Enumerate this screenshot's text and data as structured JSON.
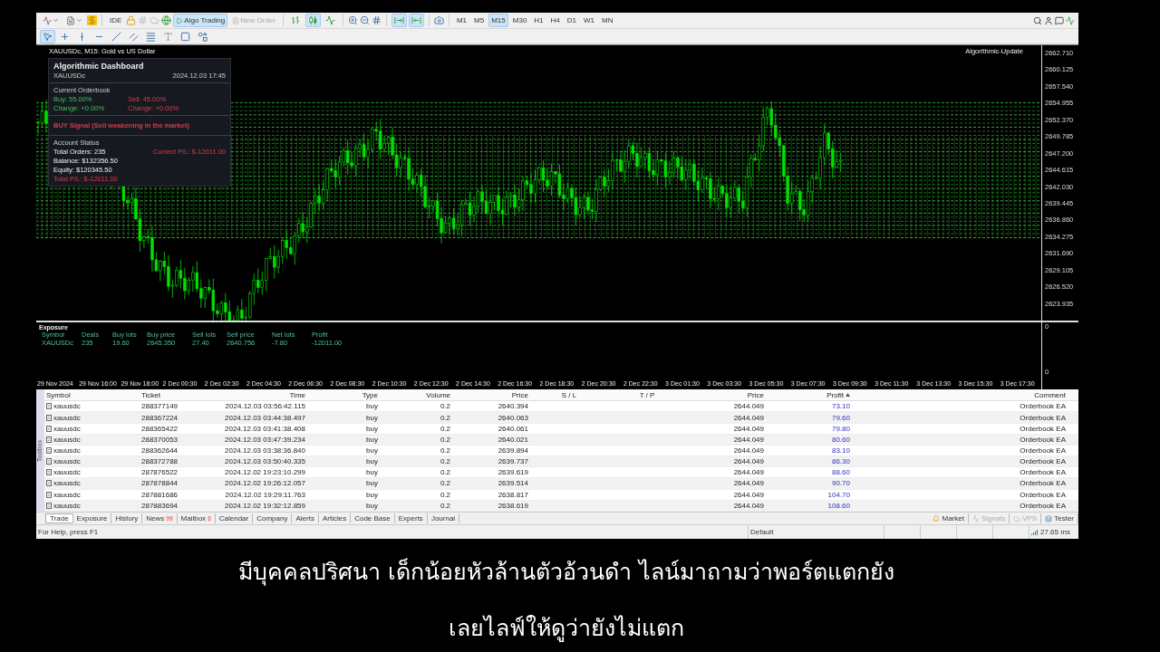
{
  "toolbar": {
    "ide_label": "IDE",
    "algo_trading": {
      "label": "Algo Trading",
      "on": true
    },
    "new_order": {
      "label": "New Order",
      "disabled": true
    },
    "chart_toggles": [
      {
        "kind": "bars",
        "selected": false
      },
      {
        "kind": "candles",
        "selected": true
      },
      {
        "kind": "line",
        "selected": false
      }
    ],
    "scroll_toggles": [
      {
        "kind": "autoscroll",
        "selected": true
      },
      {
        "kind": "shift",
        "selected": true
      }
    ],
    "timeframes": [
      {
        "label": "M1",
        "selected": false
      },
      {
        "label": "M5",
        "selected": false
      },
      {
        "label": "M15",
        "selected": true
      },
      {
        "label": "M30",
        "selected": false
      },
      {
        "label": "H1",
        "selected": false
      },
      {
        "label": "H4",
        "selected": false
      },
      {
        "label": "D1",
        "selected": false
      },
      {
        "label": "W1",
        "selected": false
      },
      {
        "label": "MN",
        "selected": false
      }
    ],
    "tools": [
      {
        "kind": "cursor",
        "selected": true
      },
      {
        "kind": "crosshair",
        "selected": false
      },
      {
        "kind": "vline",
        "selected": false
      },
      {
        "kind": "hline",
        "selected": false
      },
      {
        "kind": "trend",
        "selected": false
      },
      {
        "kind": "channel",
        "selected": false
      },
      {
        "kind": "fibo",
        "selected": false
      },
      {
        "kind": "text",
        "selected": false
      },
      {
        "kind": "rect",
        "selected": false
      },
      {
        "kind": "shapes",
        "selected": false
      }
    ]
  },
  "chart": {
    "symbol_label": "XAUUSDc, M15:  Gold vs US Dollar",
    "indicator_label": "Algorithmic-Update",
    "price_ticks": [
      "2662.710",
      "2660.125",
      "2657.540",
      "2654.955",
      "2652.370",
      "2649.785",
      "2647.200",
      "2644.615",
      "2642.030",
      "2639.445",
      "2636.860",
      "2634.275",
      "2631.690",
      "2629.105",
      "2626.520",
      "2623.935"
    ],
    "time_ticks": [
      "29 Nov 2024",
      "29 Nov 16:00",
      "29 Nov 18:00",
      "2 Dec 00:30",
      "2 Dec 02:30",
      "2 Dec 04:30",
      "2 Dec 06:30",
      "2 Dec 08:30",
      "2 Dec 10:30",
      "2 Dec 12:30",
      "2 Dec 14:30",
      "2 Dec 16:30",
      "2 Dec 18:30",
      "2 Dec 20:30",
      "2 Dec 22:30",
      "3 Dec 01:30",
      "3 Dec 03:30",
      "3 Dec 05:30",
      "3 Dec 07:30",
      "3 Dec 09:30",
      "3 Dec 11:30",
      "3 Dec 13:30",
      "3 Dec 15:30",
      "3 Dec 17:30"
    ]
  },
  "dashboard": {
    "title": "Algorithmic Dashboard",
    "symbol": "XAUUSDc",
    "datetime": "2024.12.03 17:45",
    "orderbook_title": "Current Orderbook",
    "buy": "Buy: 55.00%",
    "sell": "Sell: 45.00%",
    "buy_change": "Change: +0.00%",
    "sell_change": "Change: +0.00%",
    "signal": "BUY Signal (Sell weakening in the market)",
    "account_title": "Account Status",
    "total_orders": "Total Orders: 235",
    "current_pl": "Current P/L: $-12011.00",
    "balance": "Balance: $132356.50",
    "equity": "Equity: $120345.50",
    "total_pl": "Total P/L: $-12011.00"
  },
  "exposure": {
    "title": "Exposure",
    "columns": [
      "Symbol",
      "Deals",
      "Buy lots",
      "Buy price",
      "Sell lots",
      "Sell price",
      "Net lots",
      "Profit"
    ],
    "row": [
      "XAUUSDc",
      "235",
      "19.60",
      "2645.350",
      "27.40",
      "2640.756",
      "-7.80",
      "-12011.00"
    ],
    "axis_ticks": [
      "0",
      "0"
    ]
  },
  "table": {
    "columns": [
      "Symbol",
      "Ticket",
      "Time",
      "Type",
      "Volume",
      "Price",
      "S / L",
      "T / P",
      "Price",
      "Profit",
      "Comment"
    ],
    "rows": [
      [
        "xauusdc",
        "288377149",
        "2024.12.03 03:56:42.115",
        "buy",
        "0.2",
        "2640.394",
        "",
        "",
        "2644.049",
        "73.10",
        "Orderbook EA"
      ],
      [
        "xauusdc",
        "288367224",
        "2024.12.03 03:44:38.497",
        "buy",
        "0.2",
        "2640.063",
        "",
        "",
        "2644.049",
        "79.60",
        "Orderbook EA"
      ],
      [
        "xauusdc",
        "288365422",
        "2024.12.03 03:41:38.408",
        "buy",
        "0.2",
        "2640.061",
        "",
        "",
        "2644.049",
        "79.80",
        "Orderbook EA"
      ],
      [
        "xauusdc",
        "288370053",
        "2024.12.03 03:47:39.234",
        "buy",
        "0.2",
        "2640.021",
        "",
        "",
        "2644.049",
        "80.60",
        "Orderbook EA"
      ],
      [
        "xauusdc",
        "288362644",
        "2024.12.03 03:38:36.840",
        "buy",
        "0.2",
        "2639.894",
        "",
        "",
        "2644.049",
        "83.10",
        "Orderbook EA"
      ],
      [
        "xauusdc",
        "288372788",
        "2024.12.03 03:50:40.335",
        "buy",
        "0.2",
        "2639.737",
        "",
        "",
        "2644.049",
        "86.30",
        "Orderbook EA"
      ],
      [
        "xauusdc",
        "287876522",
        "2024.12.02 19:23:10.299",
        "buy",
        "0.2",
        "2639.619",
        "",
        "",
        "2644.049",
        "88.60",
        "Orderbook EA"
      ],
      [
        "xauusdc",
        "287878844",
        "2024.12.02 19:26:12.057",
        "buy",
        "0.2",
        "2639.514",
        "",
        "",
        "2644.049",
        "90.70",
        "Orderbook EA"
      ],
      [
        "xauusdc",
        "287881686",
        "2024.12.02 19:29:11.763",
        "buy",
        "0.2",
        "2638.817",
        "",
        "",
        "2644.049",
        "104.70",
        "Orderbook EA"
      ],
      [
        "xauusdc",
        "287883694",
        "2024.12.02 19:32:12.859",
        "buy",
        "0.2",
        "2638.619",
        "",
        "",
        "2644.049",
        "108.60",
        "Orderbook EA"
      ]
    ]
  },
  "toolbox_label": "Toolbox",
  "tabs": [
    {
      "label": "Trade",
      "selected": true
    },
    {
      "label": "Exposure",
      "selected": false
    },
    {
      "label": "History",
      "selected": false
    },
    {
      "label": "News",
      "badge": "99",
      "selected": false
    },
    {
      "label": "Mailbox",
      "badge": "6",
      "selected": false
    },
    {
      "label": "Calendar",
      "selected": false
    },
    {
      "label": "Company",
      "selected": false
    },
    {
      "label": "Alerts",
      "selected": false
    },
    {
      "label": "Articles",
      "selected": false
    },
    {
      "label": "Code Base",
      "selected": false
    },
    {
      "label": "Experts",
      "selected": false
    },
    {
      "label": "Journal",
      "selected": false
    }
  ],
  "right_tabs": [
    {
      "kind": "market",
      "label": "Market",
      "disabled": false
    },
    {
      "kind": "signals",
      "label": "Signals",
      "disabled": true
    },
    {
      "kind": "vps",
      "label": "VPS",
      "disabled": true
    },
    {
      "kind": "tester",
      "label": "Tester",
      "disabled": false
    }
  ],
  "status_bar": {
    "help": "For Help, press F1",
    "profile": "Default",
    "ping": "27.65 ms"
  },
  "subtitles": [
    "มีบุคคลปริศนา เด็กน้อยหัวล้านตัวอ้วนดำ ไลน์มาถามว่าพอร์ตแตกยัง",
    "เลยไลฟ์ให้ดูว่ายังไม่แตก"
  ]
}
